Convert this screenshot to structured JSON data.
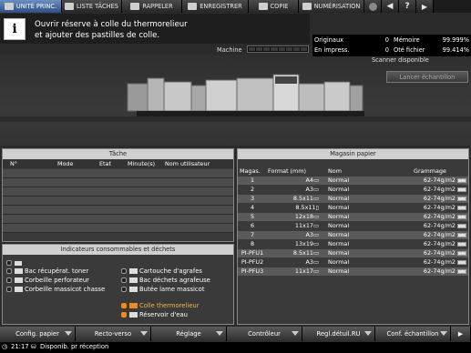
{
  "tabs": [
    {
      "label": "UNITÉ PRINC.",
      "icon": "home-icon",
      "active": true
    },
    {
      "label": "LISTE TÂCHES",
      "icon": "job-list-icon",
      "active": false
    },
    {
      "label": "RAPPELER",
      "icon": "recall-icon",
      "active": false
    },
    {
      "label": "ENREGISTRER",
      "icon": "save-icon",
      "active": false
    },
    {
      "label": "COPIE",
      "icon": "copy-icon",
      "active": false
    },
    {
      "label": "NUMÉRISATION",
      "icon": "scan-icon",
      "active": false
    }
  ],
  "message": {
    "line1": "Ouvrir réserve à colle du thermorelieur",
    "line2": "et ajouter des pastilles de colle."
  },
  "machine_label": "Machine",
  "counters": {
    "originaux_label": "Originaux",
    "originaux_value": "0",
    "memoire_label": "Mémoire",
    "memoire_value": "99.999%",
    "impress_label": "En impress.",
    "impress_value": "0",
    "fichier_label": "Oté fichier",
    "fichier_value": "99.414%"
  },
  "scanner_status": "Scanner disponible",
  "sample_button": "Lancer échantillon",
  "job_panel": {
    "title": "Tâche",
    "columns": [
      "N°",
      "Mode",
      "Etat",
      "Minute(s)",
      "Nom utilisateur"
    ],
    "rows": 7
  },
  "paper_panel": {
    "title": "Magasin papier",
    "columns": [
      "Magas.",
      "Format (mm)",
      "Nom",
      "Grammage"
    ],
    "rows": [
      {
        "tray": "1",
        "format": "A4▭",
        "name": "Normal",
        "weight": "62-74g/m2"
      },
      {
        "tray": "2",
        "format": "A3▭",
        "name": "Normal",
        "weight": "62-74g/m2"
      },
      {
        "tray": "3",
        "format": "8.5x11▭",
        "name": "Normal",
        "weight": "62-74g/m2"
      },
      {
        "tray": "4",
        "format": "8.5x11▯",
        "name": "Normal",
        "weight": "62-74g/m2"
      },
      {
        "tray": "5",
        "format": "12x18▭",
        "name": "Normal",
        "weight": "62-74g/m2"
      },
      {
        "tray": "6",
        "format": "11x17▭",
        "name": "Normal",
        "weight": "62-74g/m2"
      },
      {
        "tray": "7",
        "format": "A3▭",
        "name": "Normal",
        "weight": "62-74g/m2"
      },
      {
        "tray": "8",
        "format": "13x19▭",
        "name": "Normal",
        "weight": "62-74g/m2"
      },
      {
        "tray": "PI-PFU1",
        "format": "8.5x11▭",
        "name": "Normal",
        "weight": "62-74g/m2"
      },
      {
        "tray": "PI-PFU2",
        "format": "A3▭",
        "name": "Normal",
        "weight": "62-74g/m2"
      },
      {
        "tray": "PI-PFU3",
        "format": "11x17▭",
        "name": "Normal",
        "weight": "62-74g/m2"
      }
    ]
  },
  "consumables": {
    "title": "Indicateurs consommables et déchets",
    "left": [
      "Bac récupérat. toner",
      "Corbeille perforateur",
      "Corbeille massicot chasse"
    ],
    "right": [
      "Cartouche d'agrafes",
      "Bac déchets agrafeuse",
      "Butée lame massicot"
    ],
    "alert": [
      "Colle thermorelieur",
      "Réservoir d'eau"
    ]
  },
  "bottom_buttons": [
    "Config. papier",
    "Recto-verso",
    "Réglage",
    "Contrôleur",
    "Regl.détuil.RU",
    "Conf. échantillon"
  ],
  "status": {
    "time": "21:17",
    "text": "Disponib. pr réception"
  },
  "colors": {
    "active_tab": "#2d4f84",
    "alert_orange": "#f08a1a",
    "alert_text": "#f7b84a"
  }
}
